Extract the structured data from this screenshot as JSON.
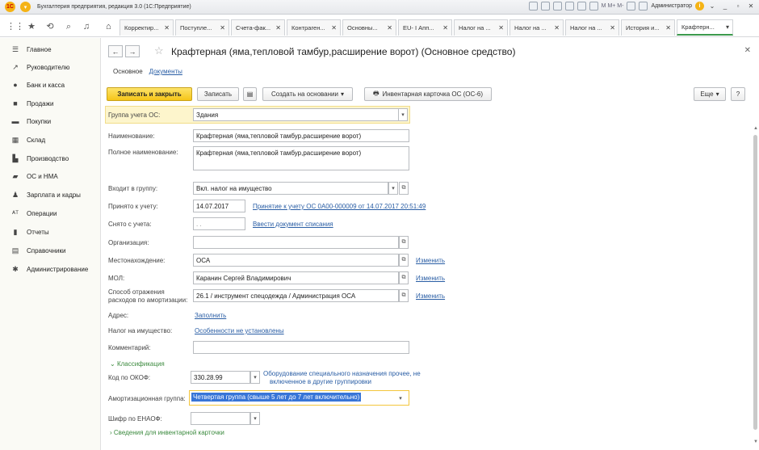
{
  "window": {
    "title": "Бухгалтерия предприятия, редакция 3.0 (1С:Предприятие)",
    "logo_text": "1С",
    "user": "Администратор",
    "m_buttons": "M  M+  M-",
    "info": "i"
  },
  "top_tabs": [
    {
      "label": "Корректир...",
      "active": false
    },
    {
      "label": "Поступле...",
      "active": false
    },
    {
      "label": "Счета-фак...",
      "active": false
    },
    {
      "label": "Контраген...",
      "active": false
    },
    {
      "label": "Основны...",
      "active": false
    },
    {
      "label": "EU- I Апп...",
      "active": false
    },
    {
      "label": "Налог на ...",
      "active": false
    },
    {
      "label": "Налог на ...",
      "active": false
    },
    {
      "label": "Налог на ...",
      "active": false
    },
    {
      "label": "История и...",
      "active": false
    },
    {
      "label": "Крафтерн...",
      "active": true
    }
  ],
  "sidebar": {
    "items": [
      {
        "label": "Главное",
        "icon": "menu-icon"
      },
      {
        "label": "Руководителю",
        "icon": "trend-icon"
      },
      {
        "label": "Банк и касса",
        "icon": "bank-icon"
      },
      {
        "label": "Продажи",
        "icon": "bag-icon"
      },
      {
        "label": "Покупки",
        "icon": "cart-icon"
      },
      {
        "label": "Склад",
        "icon": "warehouse-icon"
      },
      {
        "label": "Производство",
        "icon": "factory-icon"
      },
      {
        "label": "ОС и НМА",
        "icon": "truck-icon"
      },
      {
        "label": "Зарплата и кадры",
        "icon": "person-icon"
      },
      {
        "label": "Операции",
        "icon": "operations-icon"
      },
      {
        "label": "Отчеты",
        "icon": "chart-icon"
      },
      {
        "label": "Справочники",
        "icon": "book-icon"
      },
      {
        "label": "Администрирование",
        "icon": "gear-icon"
      }
    ]
  },
  "form": {
    "title": "Крафтерная (яма,тепловой тамбур,расширение ворот) (Основное средство)",
    "subtabs": {
      "main": "Основное",
      "docs": "Документы"
    },
    "commands": {
      "save_close": "Записать и закрыть",
      "save": "Записать",
      "create_based": "Создать на основании",
      "inventory_card": "Инвентарная карточка ОС (ОС-6)",
      "more": "Еще",
      "help": "?"
    },
    "fields": {
      "group_label": "Группа учета ОС:",
      "group_value": "Здания",
      "name_label": "Наименование:",
      "name_value": "Крафтерная (яма,тепловой тамбур,расширение ворот)",
      "fullname_label": "Полное наименование:",
      "fullname_value": "Крафтерная (яма,тепловой тамбур,расширение ворот)",
      "parent_label": "Входит в группу:",
      "parent_value": "Вкл. налог на имущество",
      "accepted_label": "Принято к учету:",
      "accepted_value": "14.07.2017",
      "accepted_link": "Принятие к учету ОС 0А00-000009 от 14.07.2017 20:51:49",
      "removed_label": "Снято с учета:",
      "removed_value": " .  . ",
      "removed_link": "Ввести документ списания",
      "org_label": "Организация:",
      "org_value": "",
      "location_label": "Местонахождение:",
      "location_value": "ОСА",
      "location_change": "Изменить",
      "mol_label": "МОЛ:",
      "mol_value": "Каранин Сергей Владимирович",
      "mol_change": "Изменить",
      "method_label_1": "Способ отражения",
      "method_label_2": "расходов по амортизации:",
      "method_value": "26.1 / инструмент спецодежда / Администрация ОСА",
      "method_change": "Изменить",
      "address_label": "Адрес:",
      "address_link": "Заполнить",
      "tax_label": "Налог на имущество:",
      "tax_link": "Особенности не установлены",
      "comment_label": "Комментарий:",
      "comment_value": ""
    },
    "classification": {
      "header": "Классификация",
      "okof_label": "Код по ОКОФ:",
      "okof_value": "330.28.99",
      "okof_note_1": "Оборудование специального назначения прочее, не",
      "okof_note_2": "включенное в другие группировки",
      "amort_label": "Амортизационная группа:",
      "amort_value": "Четвертая группа (свыше 5 лет до 7 лет включительно)",
      "enaof_label": "Шифр по ЕНАОФ:",
      "enaof_value": ""
    },
    "inventory_section": "Сведения для инвентарной карточки"
  }
}
